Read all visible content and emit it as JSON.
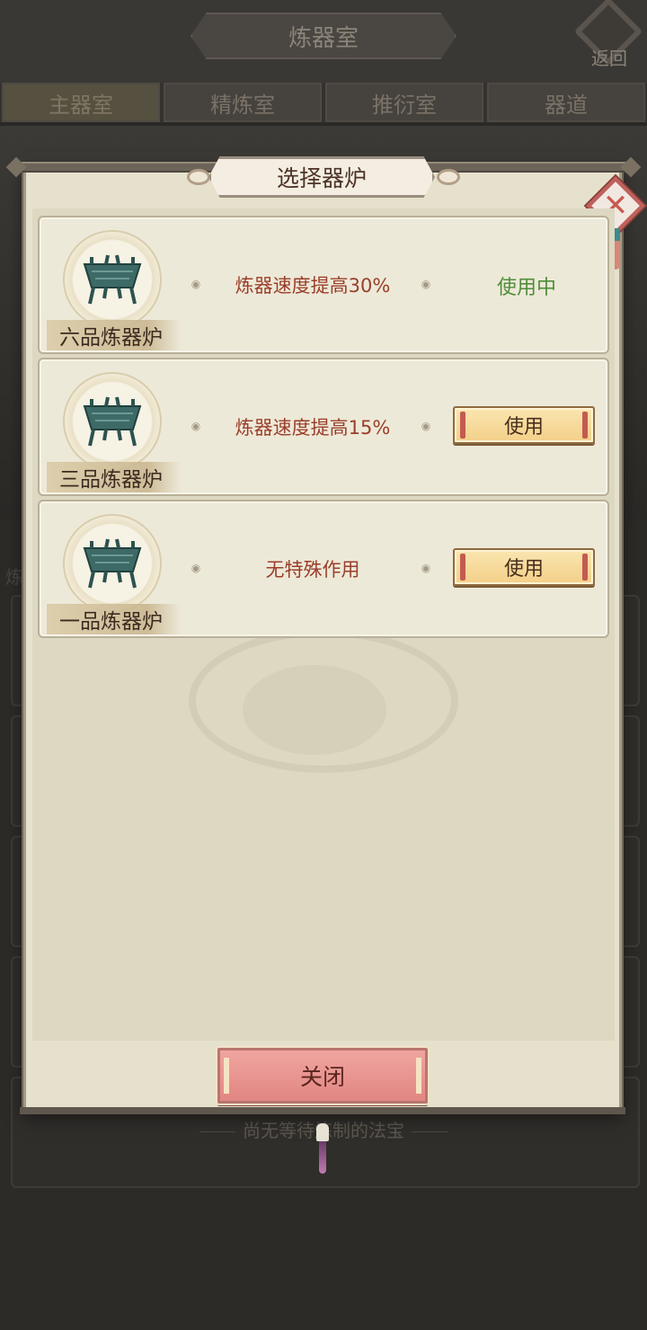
{
  "header": {
    "title": "炼器室",
    "back_label": "返回"
  },
  "tabs": [
    {
      "label": "主器室"
    },
    {
      "label": "精炼室"
    },
    {
      "label": "推衍室"
    },
    {
      "label": "器道"
    }
  ],
  "background": {
    "side_char": "炼",
    "empty_hint": "尚无等待炼制的法宝"
  },
  "dialog": {
    "title": "选择器炉",
    "close_label": "关闭",
    "items": [
      {
        "grade": "六品炼器炉",
        "effect": "炼器速度提高30%",
        "status": "使用中"
      },
      {
        "grade": "三品炼器炉",
        "effect": "炼器速度提高15%",
        "action": "使用"
      },
      {
        "grade": "一品炼器炉",
        "effect": "无特殊作用",
        "action": "使用"
      }
    ]
  },
  "colors": {
    "in_use": "#4e8e3a",
    "effect": "#9a3e2a",
    "close_button": "#e18682",
    "use_button": "#f3cf88"
  },
  "icons": {
    "furnace": "bronze-furnace-icon",
    "close": "close-x-icon",
    "ornament": "eye-ornament-icon"
  }
}
